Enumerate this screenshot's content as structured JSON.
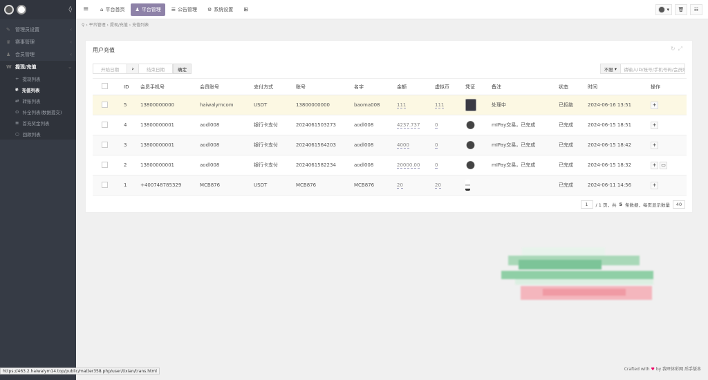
{
  "topbar": {
    "menu_icon": "menu-icon",
    "nav": [
      {
        "icon": "home-icon",
        "glyph": "⌂",
        "label": "平台首页",
        "active": false
      },
      {
        "icon": "user-icon",
        "glyph": "♟",
        "label": "平台管理",
        "active": true
      },
      {
        "icon": "list-icon",
        "glyph": "☰",
        "label": "公告管理",
        "active": false
      },
      {
        "icon": "gear-icon",
        "glyph": "⚙",
        "label": "系统设置",
        "active": false
      }
    ],
    "grid_icon": "grid-icon"
  },
  "sidebar": {
    "logo_icon": "soccer-ball-icon",
    "items": [
      {
        "label": "管理员设置",
        "icon": "wrench-icon",
        "glyph": "✎"
      },
      {
        "label": "赛事管理",
        "icon": "trophy-icon",
        "glyph": "♛"
      },
      {
        "label": "会员管理",
        "icon": "user-icon",
        "glyph": "♟"
      },
      {
        "label": "提现/充值",
        "icon": "w-icon",
        "glyph": "W",
        "open": true
      }
    ],
    "subitems": [
      {
        "label": "提现列表",
        "glyph": "+",
        "active": false
      },
      {
        "label": "充值列表",
        "glyph": "¥",
        "active": true
      },
      {
        "label": "转账列表",
        "glyph": "⇄",
        "active": false
      },
      {
        "label": "补全列表(数据提交)",
        "glyph": "⊙",
        "active": false
      },
      {
        "label": "首充奖金列表",
        "glyph": "≣",
        "active": false
      },
      {
        "label": "回款列表",
        "glyph": "○",
        "active": false
      }
    ]
  },
  "breadcrumb": [
    "平台管理",
    "提现/充值",
    "充值列表"
  ],
  "panel": {
    "title": "用户充值",
    "tool_icons": [
      "refresh-icon",
      "expand-icon"
    ]
  },
  "filters": {
    "start_placeholder": "开始日期",
    "end_placeholder": "结束日期",
    "confirm_label": "确定"
  },
  "search": {
    "select_label": "不限",
    "placeholder": "请输入ID/账号/手机号码/会员账号"
  },
  "table": {
    "columns": [
      "",
      "ID",
      "会员手机号",
      "会员账号",
      "支付方式",
      "账号",
      "名字",
      "金额",
      "虚拟币",
      "凭证",
      "备注",
      "状态",
      "时间",
      "操作"
    ],
    "rows": [
      {
        "id": "5",
        "phone": "13800000000",
        "account": "haiwalymcom",
        "method": "USDT",
        "number": "13800000000",
        "name": "baoma008",
        "amount": "111",
        "coin": "111",
        "voucher": "dark",
        "note": "处理中",
        "status": "已拒绝",
        "time": "2024-06-16 13:51",
        "actions": [
          "+"
        ]
      },
      {
        "id": "4",
        "phone": "13800000001",
        "account": "aodl008",
        "method": "银行卡支付",
        "number": "2024061503273",
        "name": "aodl008",
        "amount": "4237.737",
        "coin": "0",
        "voucher": "ball",
        "note": "mIPay交易，已完成",
        "status": "已完成",
        "time": "2024-06-15 18:51",
        "actions": [
          "+"
        ]
      },
      {
        "id": "3",
        "phone": "13800000001",
        "account": "aodl008",
        "method": "银行卡支付",
        "number": "2024061564203",
        "name": "aodl008",
        "amount": "4000",
        "coin": "0",
        "voucher": "ball",
        "note": "mIPay交易，已完成",
        "status": "已完成",
        "time": "2024-06-15 18:42",
        "actions": [
          "+"
        ]
      },
      {
        "id": "2",
        "phone": "13800000001",
        "account": "aodl008",
        "method": "银行卡支付",
        "number": "2024061582234",
        "name": "aodl008",
        "amount": "20000.00",
        "coin": "0",
        "voucher": "ball",
        "note": "mIPay交易，已完成",
        "status": "已完成",
        "time": "2024-06-15 18:32",
        "actions": [
          "+",
          "▭"
        ]
      },
      {
        "id": "1",
        "phone": "+400748785329",
        "account": "MCB876",
        "method": "USDT",
        "number": "MCB876",
        "name": "MCB876",
        "amount": "20",
        "coin": "20",
        "voucher": "small",
        "note": "",
        "status": "已完成",
        "time": "2024-06-11 14:56",
        "actions": [
          "+"
        ]
      }
    ]
  },
  "pager": {
    "page": "1",
    "summary_prefix": "/ 1 页，共",
    "total": "5",
    "summary_suffix": "条数据，每页显示数量",
    "per_page": "40"
  },
  "statusbar": "https://463.2.haiwalym14.top/public/matter358.php/user/tixian/trans.html",
  "footer": {
    "text_a": "Crafted with",
    "heart": "♥",
    "text_b": "by 我旺体彩网 后手版本"
  },
  "colors": {
    "sidebar": "#363b45",
    "active_nav": "#8e82a8",
    "highlight_row": "#fcf8e3"
  }
}
